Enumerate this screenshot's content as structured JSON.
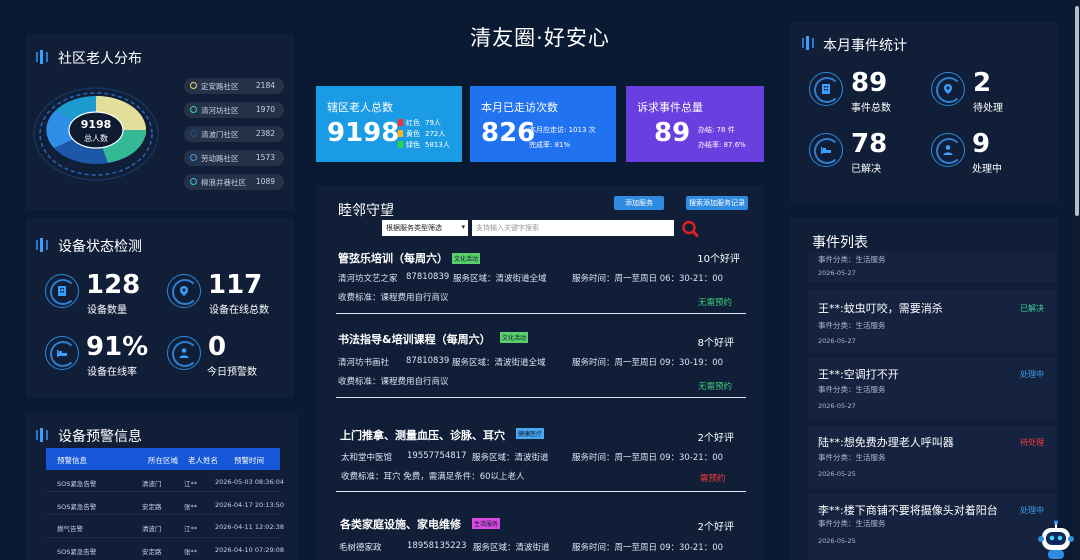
{
  "header": {
    "title": "清友圈·好安心"
  },
  "distribution": {
    "title": "社区老人分布",
    "total_value": "9198",
    "total_label": "总人数",
    "items": [
      {
        "name": "定安路社区",
        "value": "2184",
        "color": "#e8d36a"
      },
      {
        "name": "清河坊社区",
        "value": "1970",
        "color": "#3fd09a"
      },
      {
        "name": "清波门社区",
        "value": "2382",
        "color": "#1e4f96"
      },
      {
        "name": "劳动路社区",
        "value": "1573",
        "color": "#3ba0f0"
      },
      {
        "name": "柳浪井巷社区",
        "value": "1089",
        "color": "#2ec0e0"
      }
    ]
  },
  "device_status": {
    "title": "设备状态检测",
    "stats": [
      {
        "value": "128",
        "label": "设备数量",
        "icon": "building-icon"
      },
      {
        "value": "117",
        "label": "设备在线总数",
        "icon": "location-pin-icon"
      },
      {
        "value": "91%",
        "label": "设备在线率",
        "icon": "bed-icon"
      },
      {
        "value": "0",
        "label": "今日预警数",
        "icon": "person-icon"
      }
    ]
  },
  "device_warnings": {
    "title": "设备预警信息",
    "columns": [
      "预警信息",
      "所在区域",
      "老人姓名",
      "预警时间"
    ],
    "rows": [
      [
        "SOS紧急告警",
        "清波门",
        "江**",
        "2026-05-03 08:36:04"
      ],
      [
        "SOS紧急告警",
        "安定路",
        "张**",
        "2026-04-17 20:13:50"
      ],
      [
        "燃气告警",
        "清波门",
        "江**",
        "2026-04-11 12:02:38"
      ],
      [
        "SOS紧急告警",
        "安定路",
        "张**",
        "2026-04-10 07:29:08"
      ]
    ]
  },
  "cards": {
    "elders": {
      "title": "辖区老人总数",
      "value": "9198",
      "red_label": "红色",
      "red_value": "79人",
      "yellow_label": "黄色",
      "yellow_value": "272人",
      "green_label": "绿色",
      "green_value": "5813人"
    },
    "visits": {
      "title": "本月已走访次数",
      "value": "826",
      "line1": "本月应走访: 1013 次",
      "line2": "完成率: 81%"
    },
    "appeals": {
      "title": "诉求事件总量",
      "value": "89",
      "line1": "办结: 78 件",
      "line2": "办结率: 87.6%"
    },
    "colors": {
      "elders": "#1c9be5",
      "visits": "#2172f0",
      "appeals": "#6a3fe0"
    }
  },
  "services": {
    "title": "睦邻守望",
    "add_button": "添加服务",
    "search_add_button": "搜索添加服务记录",
    "filter_select": "根据服务类型筛选",
    "search_placeholder": "支持输入关键字搜索",
    "items": [
      {
        "title": "管弦乐培训（每周六）",
        "tag": "文化活动",
        "rating": "10个好评",
        "org": "清河坊文艺之家",
        "phone": "87810839",
        "area": "服务区域：清波街道全域",
        "hours": "服务时间：周一至周日 06：30-21：00",
        "fee": "收费标准：课程费用自行商议",
        "status": "无需预约"
      },
      {
        "title": "书法指导&培训课程（每周六）",
        "tag": "文化活动",
        "rating": "8个好评",
        "org": "清河坊书画社",
        "phone": "87810839",
        "area": "服务区域：清波街道全域",
        "hours": "服务时间：周一至周日 09：30-19：00",
        "fee": "收费标准：课程费用自行商议",
        "status": "无需预约"
      },
      {
        "title": "上门推拿、测量血压、诊脉、耳穴",
        "tag": "健康医疗",
        "rating": "2个好评",
        "org": "太和堂中医馆",
        "phone": "19557754817",
        "area": "服务区域：清波街道",
        "hours": "服务时间：周一至周日 09：30-21：00",
        "fee": "收费标准：耳穴   免费，需满足条件：60以上老人",
        "status": "需预约"
      },
      {
        "title": "各类家庭设施、家电维修",
        "tag": "生活服务",
        "rating": "2个好评",
        "org": "毛树德家政",
        "phone": "18958135223",
        "area": "服务区域：清波街道",
        "hours": "服务时间：周一至周日 09：30-21：00"
      }
    ]
  },
  "monthly_stats": {
    "title": "本月事件统计",
    "stats": [
      {
        "value": "89",
        "label": "事件总数",
        "icon": "building-icon"
      },
      {
        "value": "2",
        "label": "待处理",
        "icon": "location-pin-icon"
      },
      {
        "value": "78",
        "label": "已解决",
        "icon": "bed-icon"
      },
      {
        "value": "9",
        "label": "处理中",
        "icon": "person-icon"
      }
    ]
  },
  "events": {
    "title": "事件列表",
    "partial": {
      "category": "事件分类：生活服务",
      "date": "2026-05-27"
    },
    "items": [
      {
        "title": "王**:蚊虫叮咬，需要消杀",
        "status": "已解决",
        "status_color": "#3fd09a",
        "category": "事件分类：生活服务",
        "date": "2026-05-27"
      },
      {
        "title": "王**:空调打不开",
        "status": "处理中",
        "status_color": "#3ba0f0",
        "category": "事件分类：生活服务",
        "date": "2026-05-27"
      },
      {
        "title": "陆**:想免费办理老人呼叫器",
        "status": "待处理",
        "status_color": "#ff3b3b",
        "category": "事件分类：生活服务",
        "date": "2026-05-25"
      },
      {
        "title": "李**:楼下商铺不要将摄像头对着阳台",
        "status": "处理中",
        "status_color": "#3ba0f0",
        "category": "事件分类：生活服务",
        "date": "2026-05-25"
      }
    ]
  }
}
